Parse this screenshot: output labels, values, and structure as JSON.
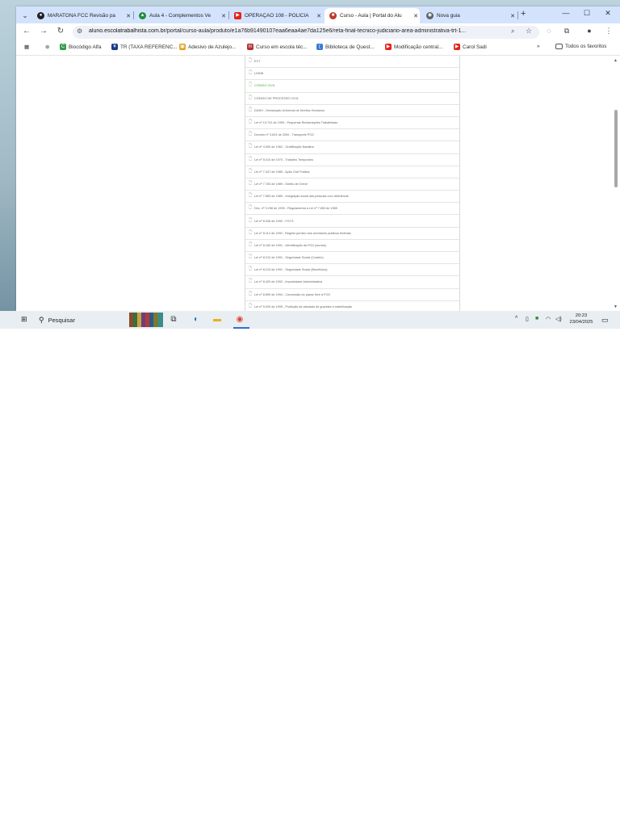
{
  "browser": {
    "tabs": [
      {
        "title": "MARATONA FCC Revisão pa",
        "icon_color": "#202124",
        "active": false
      },
      {
        "title": "Aula 4 - Complementos Ve",
        "icon_color": "#1f8e3d",
        "active": false
      },
      {
        "title": "OPERAÇÃO 108 - POLÍCIA",
        "icon_color": "#e62117",
        "active": false
      },
      {
        "title": "Curso - Aula | Portal do Alu",
        "icon_color": "#c0392b",
        "active": true
      },
      {
        "title": "Nova guia",
        "icon_color": "#5f6368",
        "active": false
      }
    ],
    "new_tab_glyph": "+",
    "window_controls": {
      "minimize": "—",
      "maximize": "☐",
      "close": "✕"
    },
    "address": {
      "host": "aluno.escolatrabalhista.com.br",
      "path": "/portal/curso-aula/produto/e1a76b91490107eaa6eaa4ae7da125e6/reta-final-tecnico-judiciario-area-administrativa-trt-1..."
    },
    "bookmarks": [
      {
        "label": "Biocódigo Alfa",
        "icon": "green-square-icon",
        "color": "#2e9e48"
      },
      {
        "label": "TR (TAXA REFERENC...",
        "icon": "chart-icon",
        "color": "#1a3b8a"
      },
      {
        "label": "Adesivo de Azulejo...",
        "icon": "tile-icon",
        "color": "#e0a020"
      },
      {
        "label": "Curso em escola téc...",
        "icon": "school-icon",
        "color": "#b03030"
      },
      {
        "label": "Biblioteca de Quest...",
        "icon": "leaf-icon",
        "color": "#3a7bd5"
      },
      {
        "label": "Modificação central...",
        "icon": "youtube-icon",
        "color": "#e62117"
      },
      {
        "label": "Carol Sadi",
        "icon": "youtube-icon",
        "color": "#e62117"
      }
    ],
    "bookmarks_overflow": "»",
    "all_bookmarks": "Todos os favoritos"
  },
  "page": {
    "items": [
      {
        "text": "ECT",
        "highlight": false
      },
      {
        "text": "LINDB",
        "highlight": false
      },
      {
        "text": "CÓDIGO CIVIL",
        "highlight": true
      },
      {
        "text": "CÓDIGO DE PROCESSO CIVIL",
        "highlight": false
      },
      {
        "text": "DUDH - Declaração Universal de Direitos Humanos",
        "highlight": false
      },
      {
        "text": "Lei nº 10.741 de 1999 - Pequenas Reclamações Trabalhistas",
        "highlight": false
      },
      {
        "text": "Decreto nº 3.691 de 2000 - Transporte PCD",
        "highlight": false
      },
      {
        "text": "Lei nº 4.090 de 1962 - Gratificação Natalina",
        "highlight": false
      },
      {
        "text": "Lei nº 5.010 de 1970 - Trabalho Temporário",
        "highlight": false
      },
      {
        "text": "Lei nº 7.347 de 1985 - Ação Civil Pública",
        "highlight": false
      },
      {
        "text": "Lei nº 7.783 de 1989 - Direito de Greve",
        "highlight": false
      },
      {
        "text": "Lei nº 7.853 de 1989 - Integração social das pessoas com deficiência",
        "highlight": false
      },
      {
        "text": "Dec. nº 3.298 de 1999 - Regulamenta a Lei nº 7.853 de 1989",
        "highlight": false
      },
      {
        "text": "Lei nº 8.036 de 1990 - FGTS",
        "highlight": false
      },
      {
        "text": "Lei nº 8.112 de 1990 - Regime jurídico dos servidores públicos federais",
        "highlight": false
      },
      {
        "text": "Lei nº 8.160 de 1991 - Identificação da PCD (surdos)",
        "highlight": false
      },
      {
        "text": "Lei nº 8.212 de 1991 - Seguridade Social (Custeio)",
        "highlight": false
      },
      {
        "text": "Lei nº 8.213 de 1991 - Seguridade Social (Benefícios)",
        "highlight": false
      },
      {
        "text": "Lei nº 8.429 de 1992 - Improbidade Administrativa",
        "highlight": false
      },
      {
        "text": "Lei nº 8.899 de 1994 - Concessão do passe livre à PCD",
        "highlight": false
      },
      {
        "text": "Lei nº 9.029 de 1995 - Proibição de atestado de gravidez e esterilização",
        "highlight": false
      }
    ]
  },
  "taskbar": {
    "search_label": "Pesquisar",
    "time": "20:23",
    "date": "23/04/2025"
  },
  "colors": {
    "tab_strip": "#d3e3fd",
    "accent": "#2f6fd6",
    "highlight_text": "#48a63b"
  }
}
